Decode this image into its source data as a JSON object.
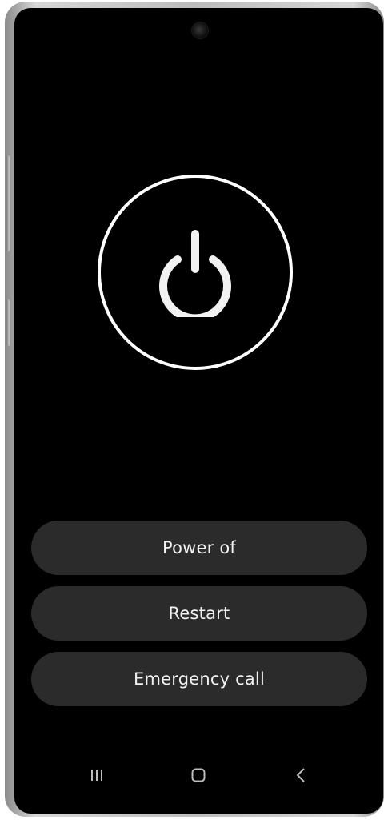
{
  "power_menu": {
    "icon": "power-icon",
    "options": [
      {
        "label": "Power of"
      },
      {
        "label": "Restart"
      },
      {
        "label": "Emergency call"
      }
    ]
  },
  "navigation_bar": {
    "recent_icon": "recent-apps-icon",
    "home_icon": "home-icon",
    "back_icon": "back-icon"
  },
  "colors": {
    "screen_background": "#000000",
    "button_background": "#2b2b2b",
    "foreground": "#ffffff"
  }
}
